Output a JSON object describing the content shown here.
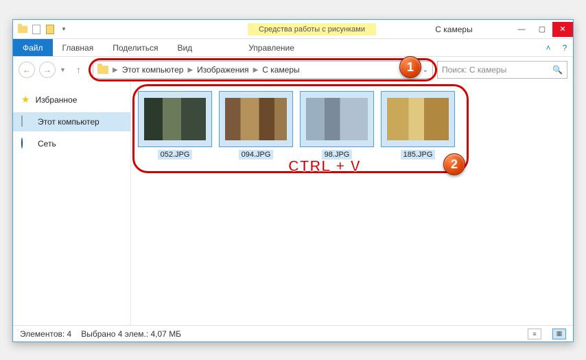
{
  "title": "С камеры",
  "context_tab": "Средства работы с рисунками",
  "ribbon": {
    "file": "Файл",
    "home": "Главная",
    "share": "Поделиться",
    "view": "Вид",
    "manage": "Управление"
  },
  "breadcrumb": {
    "root": "Этот компьютер",
    "level1": "Изображения",
    "level2": "С камеры"
  },
  "search": {
    "placeholder": "Поиск: С камеры"
  },
  "sidebar": {
    "favorites": "Избранное",
    "this_pc": "Этот компьютер",
    "network": "Сеть"
  },
  "files": [
    {
      "name": "052.JPG"
    },
    {
      "name": "094.JPG"
    },
    {
      "name": "98.JPG"
    },
    {
      "name": "185.JPG"
    }
  ],
  "status": {
    "items_label": "Элементов: 4",
    "selection_label": "Выбрано 4 элем.: 4,07 МБ"
  },
  "annotations": {
    "shortcut": "CTRL + V",
    "badge1": "1",
    "badge2": "2"
  },
  "colors": {
    "accent": "#1979ca",
    "highlight": "#d60000",
    "selection": "#cfe6f7"
  }
}
